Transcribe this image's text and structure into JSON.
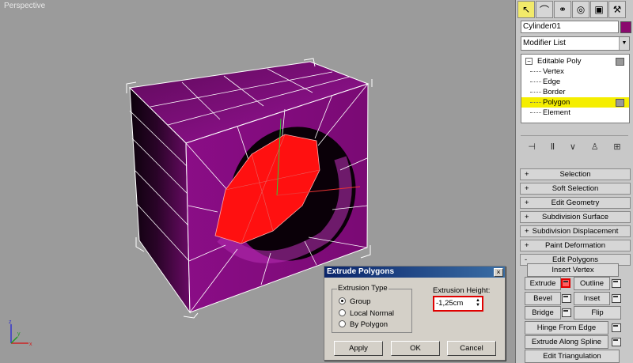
{
  "viewport": {
    "label": "Perspective"
  },
  "panel": {
    "tabs": [
      {
        "icon": "cursor-arrow-icon"
      },
      {
        "icon": "modify-curve-icon"
      },
      {
        "icon": "hierarchy-icon"
      },
      {
        "icon": "motion-icon"
      },
      {
        "icon": "display-monitor-icon"
      },
      {
        "icon": "utilities-hammer-icon"
      }
    ],
    "object_name": "Cylinder01",
    "object_color": "#8a0a6e",
    "modifier_list": "Modifier List",
    "stack": {
      "root": "Editable Poly",
      "items": [
        "Vertex",
        "Edge",
        "Border",
        "Polygon",
        "Element"
      ],
      "selected": "Polygon"
    },
    "stack_tools": [
      "pin-stack-icon",
      "show-end-result-icon",
      "make-unique-icon",
      "remove-modifier-icon",
      "configure-sets-icon"
    ],
    "rollouts": [
      {
        "sign": "+",
        "label": "Selection"
      },
      {
        "sign": "+",
        "label": "Soft Selection"
      },
      {
        "sign": "+",
        "label": "Edit Geometry"
      },
      {
        "sign": "+",
        "label": "Subdivision Surface"
      },
      {
        "sign": "+",
        "label": "Subdivision Displacement"
      },
      {
        "sign": "+",
        "label": "Paint Deformation"
      },
      {
        "sign": "-",
        "label": "Edit Polygons"
      }
    ],
    "edit_polygons": {
      "insert_vertex": "Insert Vertex",
      "extrude": "Extrude",
      "outline": "Outline",
      "bevel": "Bevel",
      "inset": "Inset",
      "bridge": "Bridge",
      "flip": "Flip",
      "hinge": "Hinge From Edge",
      "extrude_spline": "Extrude Along Spline",
      "edit_tri": "Edit Triangulation"
    }
  },
  "dialog": {
    "title": "Extrude Polygons",
    "close": "×",
    "group_title": "Extrusion Type",
    "options": [
      "Group",
      "Local Normal",
      "By Polygon"
    ],
    "selected_option": "Group",
    "height_label": "Extrusion Height:",
    "height_value": "-1,25cm",
    "buttons": {
      "apply": "Apply",
      "ok": "OK",
      "cancel": "Cancel"
    }
  },
  "colors": {
    "viewport_bg": "#9b9b9b",
    "object": "#7d0a78",
    "selection": "#ff0000",
    "stack_highlight": "#f5ee00"
  }
}
